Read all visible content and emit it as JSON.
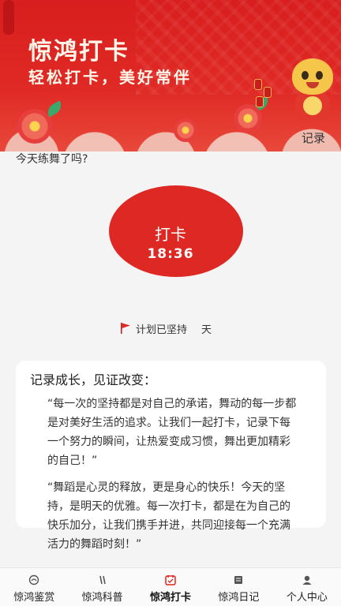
{
  "banner": {
    "title": "惊鸿打卡",
    "subtitle": "轻松打卡，美好常伴"
  },
  "header": {
    "record_link": "记录"
  },
  "main": {
    "question": "今天练舞了吗?",
    "punch_label": "打卡",
    "punch_time": "18:36",
    "plan_text": "计划已坚持",
    "plan_days_unit": "天",
    "accent_color": "#dd2823"
  },
  "card": {
    "heading": "记录成长，见证改变：",
    "quotes": [
      "“每一次的坚持都是对自己的承诺，舞动的每一步都是对美好生活的追求。让我们一起打卡，记录下每一个努力的瞬间，让热爱变成习惯，舞出更加精彩的自己！”",
      "“舞蹈是心灵的释放，更是身心的快乐！今天的坚持，是明天的优雅。每一次打卡，都是在为自己的快乐加分，让我们携手并进，共同迎接每一个充满活力的舞蹈时刻！”"
    ]
  },
  "nav": {
    "items": [
      {
        "label": "惊鸿鉴赏",
        "icon": "appreciate-icon"
      },
      {
        "label": "惊鸿科普",
        "icon": "science-icon"
      },
      {
        "label": "惊鸿打卡",
        "icon": "calendar-check-icon"
      },
      {
        "label": "惊鸿日记",
        "icon": "diary-icon"
      },
      {
        "label": "个人中心",
        "icon": "user-icon"
      }
    ],
    "active_index": 2,
    "active_color": "#dd2823"
  }
}
